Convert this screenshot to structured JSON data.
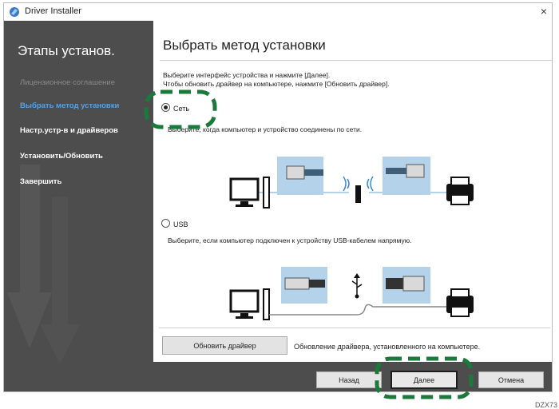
{
  "window": {
    "title": "Driver Installer",
    "close_glyph": "×"
  },
  "sidebar": {
    "heading": "Этапы установ.",
    "steps": [
      {
        "label": "Лицензионное соглашение",
        "state": "done"
      },
      {
        "label": "Выбрать метод установки",
        "state": "active"
      },
      {
        "label": "Настр.устр-в и драйверов",
        "state": "pending"
      },
      {
        "label": "Установить/Обновить",
        "state": "pending"
      },
      {
        "label": "Завершить",
        "state": "pending"
      }
    ]
  },
  "main": {
    "title": "Выбрать метод установки",
    "instruction_line1": "Выберите интерфейс устройства и нажмите [Далее].",
    "instruction_line2": "Чтобы обновить драйвер на компьютере, нажмите [Обновить драйвер].",
    "options": [
      {
        "label": "Сеть",
        "selected": true,
        "description": "Выберите, когда компьютер и устройство соединены по сети."
      },
      {
        "label": "USB",
        "selected": false,
        "description": "Выберите, если компьютер подключен к устройству USB-кабелем напрямую."
      }
    ],
    "update_button": "Обновить драйвер",
    "update_description": "Обновление драйвера, установленного на компьютере."
  },
  "footer": {
    "back": "Назад",
    "next": "Далее",
    "cancel": "Отмена"
  },
  "figure_code": "DZX73",
  "colors": {
    "sidebar_bg": "#4d4d4d",
    "active_step": "#5aa0e0",
    "highlight": "#1a7a3c",
    "diagram_blue": "#b4d3ea"
  },
  "icons": [
    "app-icon",
    "computer-icon",
    "ethernet-plug-icon",
    "wireless-router-icon",
    "printer-icon",
    "usb-plug-icon",
    "usb-symbol-icon"
  ]
}
